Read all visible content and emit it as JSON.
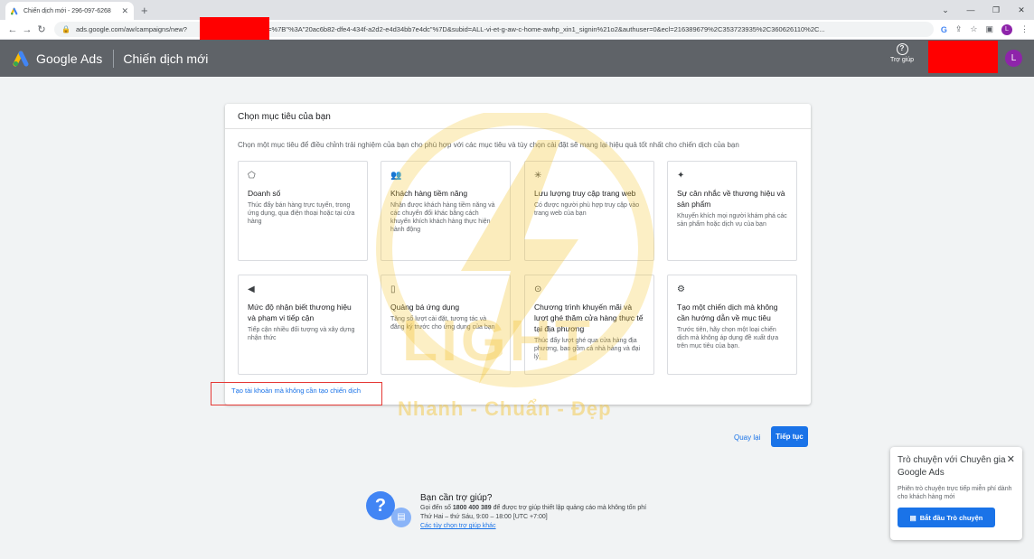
{
  "browser": {
    "tab_title": "Chiến dịch mới - 296-097-6268",
    "url": "ads.google.com/aw/campaigns/new?campaignInfo=%7B\"%3A\"20ac6b82-dfe4-434f-a2d2-e4d34bb7e4dc\"%7D&subid=ALL-vi-et-g-aw-c-home-awhp_xin1_signin%21o2&authuser=0&ecl=216389679%2C353723935%2C360626110%2C...",
    "url_visible": "ads.google.com/aw/campaigns/new?",
    "url_rest": "mpnInfo=%7B\"%3A\"20ac6b82-dfe4-434f-a2d2-e4d34bb7e4dc\"%7D&subid=ALL-vi-et-g-aw-c-home-awhp_xin1_signin%21o2&authuser=0&ecl=216389679%2C353723935%2C360626110%2C...",
    "profile_initial": "L"
  },
  "header": {
    "brand": "Google Ads",
    "page_title": "Chiến dịch mới",
    "help_label": "Trợ giúp",
    "avatar_initial": "L"
  },
  "card": {
    "title": "Chọn mục tiêu của bạn",
    "subtitle": "Chọn một mục tiêu để điều chỉnh trải nghiệm của bạn cho phù hợp với các mục tiêu và tùy chọn cài đặt sẽ mang lại hiệu quả tốt nhất cho chiến dịch của bạn",
    "objectives": [
      {
        "icon": "tag-icon",
        "glyph": "⬠",
        "title": "Doanh số",
        "desc": "Thúc đẩy bán hàng trực tuyến, trong ứng dụng, qua điện thoại hoặc tại cửa hàng"
      },
      {
        "icon": "people-icon",
        "glyph": "👥",
        "title": "Khách hàng tiềm năng",
        "desc": "Nhận được khách hàng tiềm năng và các chuyển đổi khác bằng cách khuyến khích khách hàng thực hiện hành động"
      },
      {
        "icon": "cursor-click-icon",
        "glyph": "✳",
        "title": "Lưu lượng truy cập trang web",
        "desc": "Có được người phù hợp truy cập vào trang web của bạn"
      },
      {
        "icon": "sparkle-icon",
        "glyph": "✦",
        "title": "Sự cân nhắc về thương hiệu và sản phẩm",
        "desc": "Khuyến khích mọi người khám phá các sản phẩm hoặc dịch vụ của bạn"
      },
      {
        "icon": "megaphone-icon",
        "glyph": "◀",
        "title": "Mức độ nhận biết thương hiệu và phạm vi tiếp cận",
        "desc": "Tiếp cận nhiều đối tượng và xây dựng nhận thức"
      },
      {
        "icon": "phone-icon",
        "glyph": "▯",
        "title": "Quảng bá ứng dụng",
        "desc": "Tăng số lượt cài đặt, tương tác và đăng ký trước cho ứng dụng của bạn"
      },
      {
        "icon": "location-pin-icon",
        "glyph": "⊙",
        "title": "Chương trình khuyến mãi và lượt ghé thăm cửa hàng thực tế tại địa phương",
        "desc": "Thúc đẩy lượt ghé qua cửa hàng địa phương, bao gồm cả nhà hàng và đại lý."
      },
      {
        "icon": "gear-icon",
        "glyph": "⚙",
        "title": "Tạo một chiến dịch mà không cần hướng dẫn về mục tiêu",
        "desc": "Trước tiên, hãy chọn một loại chiến dịch mà không áp dụng đề xuất dựa trên mục tiêu của bạn."
      }
    ],
    "create_account_link": "Tạo tài khoản mà không cần tạo chiến dịch"
  },
  "watermark": {
    "word": "LIGHT",
    "tagline": "Nhanh - Chuẩn - Đẹp"
  },
  "actions": {
    "back": "Quay lại",
    "next": "Tiếp tục"
  },
  "help_section": {
    "title": "Bạn cần trợ giúp?",
    "line1_prefix": "Gọi đến số ",
    "phone": "1800 400 389",
    "line1_suffix": " để được trợ giúp thiết lập quảng cáo mà không tốn phí",
    "hours": "Thứ Hai – thứ Sáu, 9:00 – 18:00 [UTC +7:00]",
    "other_options": "Các tùy chọn trợ giúp khác"
  },
  "chat": {
    "title": "Trò chuyện với Chuyên gia Google Ads",
    "desc": "Phiên trò chuyện trực tiếp miễn phí dành cho khách hàng mới",
    "button": "Bắt đầu Trò chuyện"
  }
}
